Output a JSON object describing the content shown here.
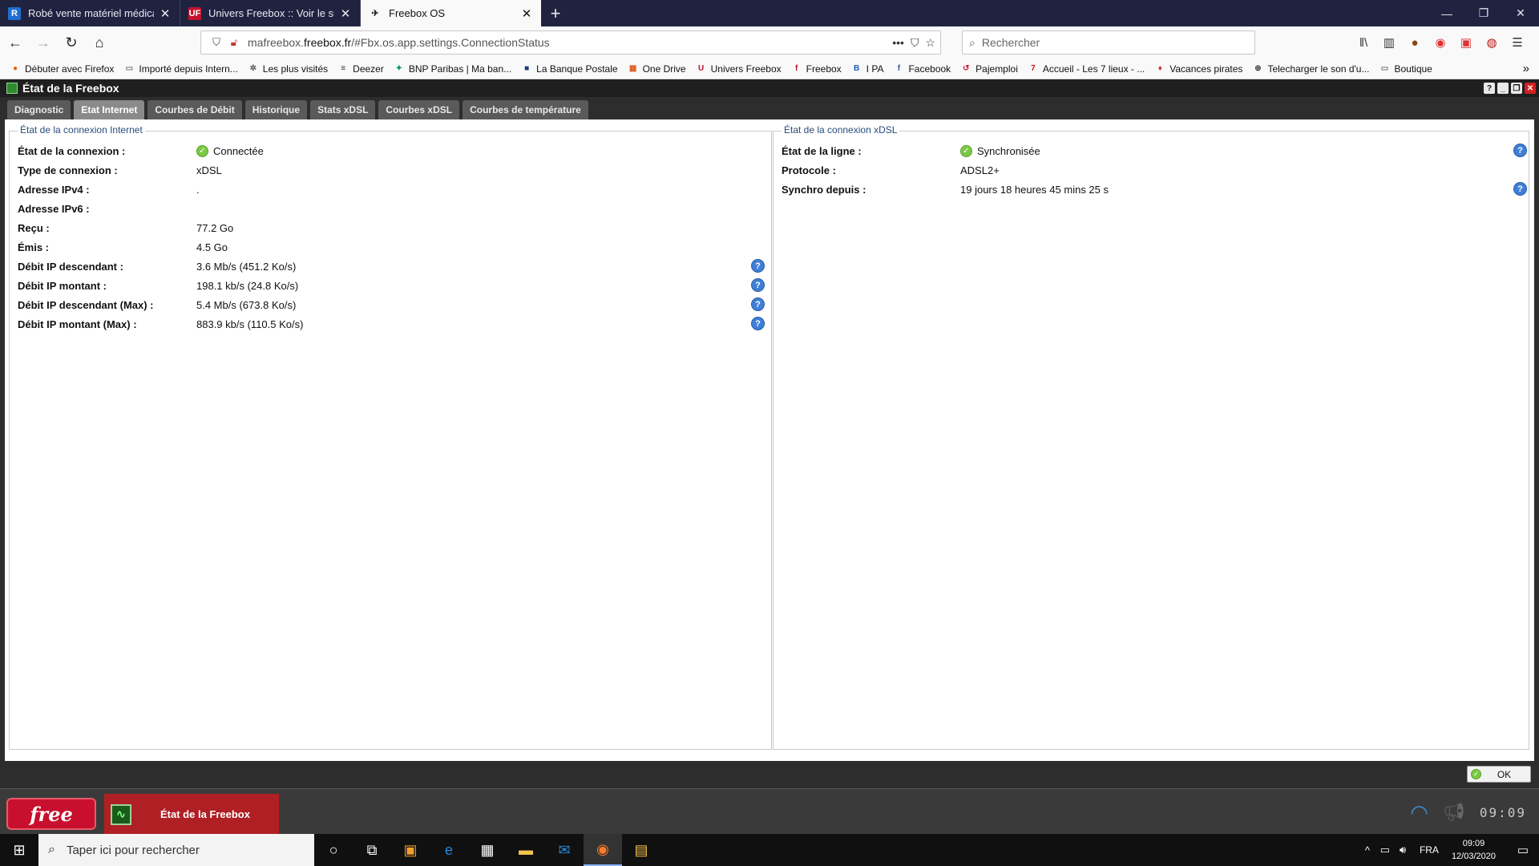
{
  "browser": {
    "tabs": [
      {
        "title": "Robé vente matériel médical",
        "icon_text": "R",
        "icon_bg": "#1e6fd0"
      },
      {
        "title": "Univers Freebox :: Voir le sujet -",
        "icon_text": "UF",
        "icon_bg": "#c8102e"
      },
      {
        "title": "Freebox OS",
        "icon_text": "✈",
        "icon_bg": "transparent"
      }
    ],
    "url_host": "mafreebox.freebox.fr",
    "url_path": "/#Fbx.os.app.settings.ConnectionStatus",
    "url_prefix": "mafreebox.",
    "url_domain": "freebox.fr",
    "search_placeholder": "Rechercher",
    "bookmarks": [
      {
        "label": "Débuter avec Firefox",
        "icon": "●",
        "color": "#e66000"
      },
      {
        "label": "Importé depuis Intern...",
        "icon": "▭",
        "color": "#777"
      },
      {
        "label": "Les plus visités",
        "icon": "✲",
        "color": "#555"
      },
      {
        "label": "Deezer",
        "icon": "≡",
        "color": "#333"
      },
      {
        "label": "BNP Paribas | Ma ban...",
        "icon": "✦",
        "color": "#00915a"
      },
      {
        "label": "La Banque Postale",
        "icon": "■",
        "color": "#1d3c78"
      },
      {
        "label": "One Drive",
        "icon": "▦",
        "color": "#e05a1e"
      },
      {
        "label": "Univers Freebox",
        "icon": "U",
        "color": "#c8102e"
      },
      {
        "label": "Freebox",
        "icon": "f",
        "color": "#c8102e"
      },
      {
        "label": "I PA",
        "icon": "B",
        "color": "#1c5bb8"
      },
      {
        "label": "Facebook",
        "icon": "f",
        "color": "#3b5998"
      },
      {
        "label": "Pajemploi",
        "icon": "↺",
        "color": "#c8102e"
      },
      {
        "label": "Accueil - Les 7 lieux - ...",
        "icon": "7",
        "color": "#d11"
      },
      {
        "label": "Vacances pirates",
        "icon": "♦",
        "color": "#c0392b"
      },
      {
        "label": "Telecharger le son d'u...",
        "icon": "⊕",
        "color": "#444"
      },
      {
        "label": "Boutique",
        "icon": "▭",
        "color": "#777"
      }
    ]
  },
  "window": {
    "title": "État de la Freebox",
    "tabs": [
      "Diagnostic",
      "Etat Internet",
      "Courbes de Débit",
      "Historique",
      "Stats xDSL",
      "Courbes xDSL",
      "Courbes de température"
    ],
    "active_tab": 1,
    "ok_label": "OK"
  },
  "internet": {
    "legend": "État de la connexion Internet",
    "rows": [
      {
        "label": "État de la connexion :",
        "value": "Connectée",
        "status": "ok",
        "help": false
      },
      {
        "label": "Type de connexion :",
        "value": "xDSL",
        "help": false
      },
      {
        "label": "Adresse IPv4 :",
        "value": ".",
        "help": false
      },
      {
        "label": "Adresse IPv6 :",
        "value": "",
        "help": false
      },
      {
        "label": "Reçu :",
        "value": "77.2 Go",
        "help": false
      },
      {
        "label": "Émis :",
        "value": "4.5 Go",
        "help": false
      },
      {
        "label": "Débit IP descendant :",
        "value": "3.6 Mb/s (451.2 Ko/s)",
        "help": true
      },
      {
        "label": "Débit IP montant :",
        "value": "198.1 kb/s (24.8 Ko/s)",
        "help": true
      },
      {
        "label": "Débit IP descendant (Max) :",
        "value": "5.4 Mb/s (673.8 Ko/s)",
        "help": true
      },
      {
        "label": "Débit IP montant (Max) :",
        "value": "883.9 kb/s (110.5 Ko/s)",
        "help": true
      }
    ]
  },
  "xdsl": {
    "legend": "État de la connexion xDSL",
    "rows": [
      {
        "label": "État de la ligne :",
        "value": "Synchronisée",
        "status": "ok",
        "help": true
      },
      {
        "label": "Protocole :",
        "value": "ADSL2+",
        "help": false
      },
      {
        "label": "Synchro depuis :",
        "value": "19 jours 18 heures 45 mins 25 s",
        "help": true
      }
    ]
  },
  "dock": {
    "logo": "free",
    "task": "État de la Freebox",
    "clock": "09:09"
  },
  "taskbar": {
    "search_placeholder": "Taper ici pour rechercher",
    "lang": "FRA",
    "time": "09:09",
    "date": "12/03/2020"
  }
}
